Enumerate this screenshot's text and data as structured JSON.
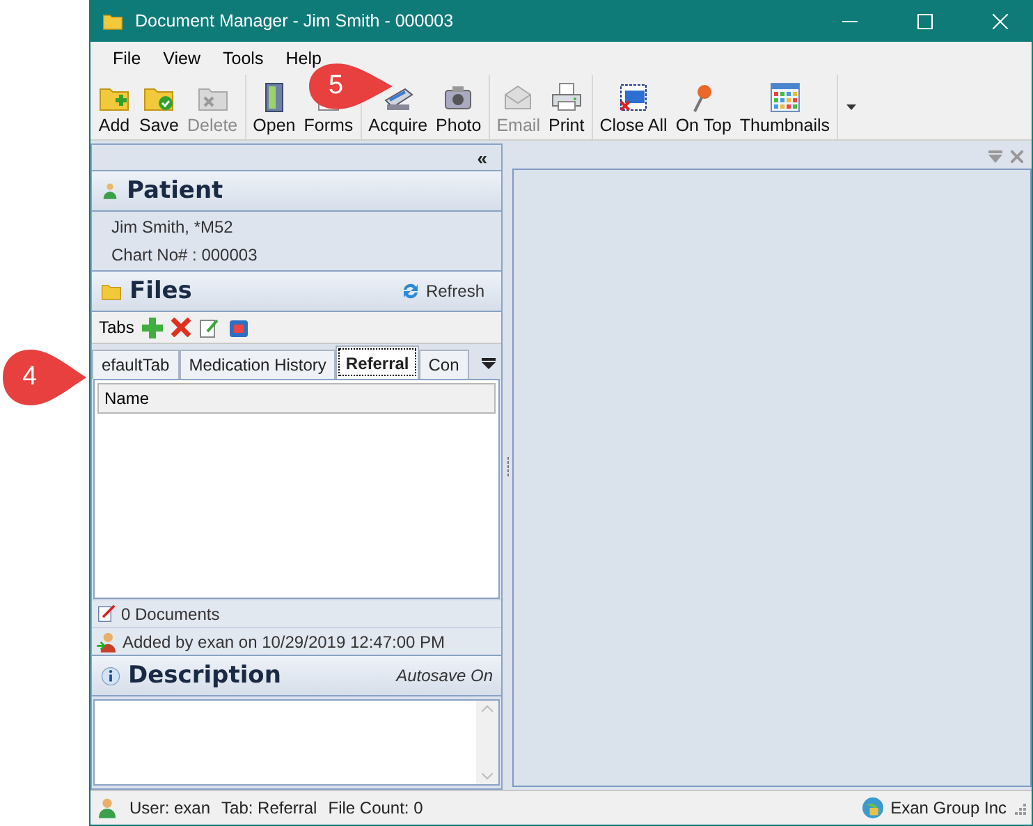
{
  "window": {
    "title": "Document Manager - Jim Smith - 000003"
  },
  "menu": [
    "File",
    "View",
    "Tools",
    "Help"
  ],
  "toolbar": {
    "groups": [
      [
        {
          "label": "Add",
          "disabled": false
        },
        {
          "label": "Save",
          "disabled": false
        },
        {
          "label": "Delete",
          "disabled": true
        }
      ],
      [
        {
          "label": "Open",
          "disabled": false
        },
        {
          "label": "Forms",
          "disabled": false
        }
      ],
      [
        {
          "label": "Acquire",
          "disabled": false
        },
        {
          "label": "Photo",
          "disabled": false
        }
      ],
      [
        {
          "label": "Email",
          "disabled": true
        },
        {
          "label": "Print",
          "disabled": false
        }
      ],
      [
        {
          "label": "Close All",
          "disabled": false
        },
        {
          "label": "On Top",
          "disabled": false
        },
        {
          "label": "Thumbnails",
          "disabled": false
        }
      ]
    ]
  },
  "collapse_button": "«",
  "patient": {
    "title": "Patient",
    "lines": [
      "Jim Smith, *M52",
      "Chart No# : 000003"
    ]
  },
  "files": {
    "title": "Files",
    "refresh": "Refresh",
    "tabs_label": "Tabs",
    "tabs": [
      {
        "label": "efaultTab",
        "selected": false
      },
      {
        "label": "Medication History",
        "selected": false
      },
      {
        "label": "Referral",
        "selected": true
      },
      {
        "label": "Con",
        "selected": false
      }
    ],
    "columns": [
      "Name"
    ],
    "count": "0 Documents",
    "added": "Added by exan on 10/29/2019 12:47:00 PM"
  },
  "description": {
    "title": "Description",
    "autosave": "Autosave On"
  },
  "status_bar": {
    "user": "User: exan",
    "tab": "Tab:  Referral",
    "file_count": "File Count:  0",
    "company": "Exan Group Inc"
  },
  "callouts": [
    "4",
    "5"
  ]
}
